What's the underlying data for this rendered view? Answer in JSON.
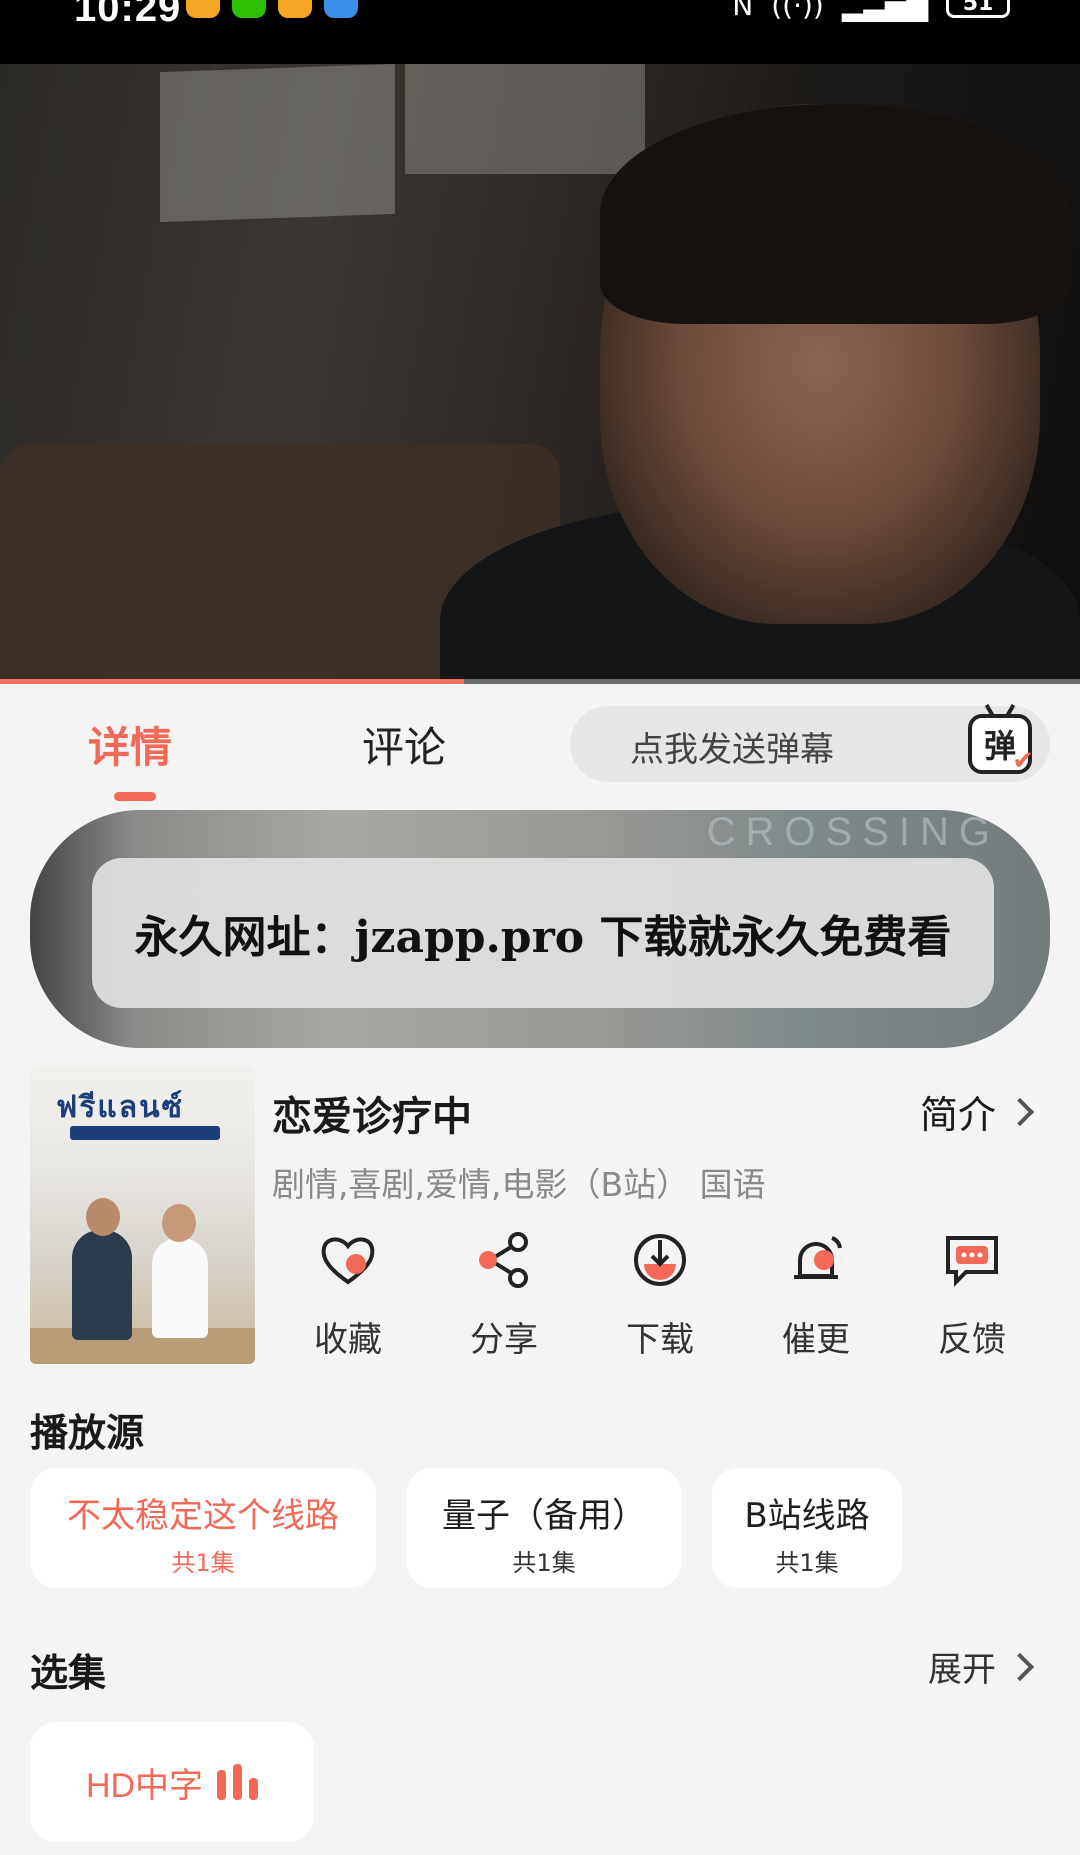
{
  "status_bar": {
    "time": "10:29",
    "battery": "51"
  },
  "video": {
    "progress_fraction": 0.43
  },
  "tabs": {
    "detail": "详情",
    "comment": "评论",
    "active": "detail"
  },
  "danmaku": {
    "placeholder": "点我发送弹幕",
    "icon_glyph": "弹"
  },
  "banner": {
    "text": "永久网址：jzapp.pro 下载就永久免费看",
    "bg_text": "CROSSING"
  },
  "poster": {
    "title": "ฟรีแลนซ์"
  },
  "show": {
    "title": "恋爱诊疗中",
    "intro_label": "简介",
    "meta": "剧情,喜剧,爱情,电影（B站） 国语"
  },
  "actions": [
    {
      "label": "收藏",
      "icon": "heart-icon"
    },
    {
      "label": "分享",
      "icon": "share-icon"
    },
    {
      "label": "下载",
      "icon": "download-icon"
    },
    {
      "label": "催更",
      "icon": "bell-icon"
    },
    {
      "label": "反馈",
      "icon": "feedback-icon"
    }
  ],
  "play_sources": {
    "title": "播放源",
    "items": [
      {
        "name": "不太稳定这个线路",
        "count": "共1集",
        "active": true
      },
      {
        "name": "量子（备用）",
        "count": "共1集",
        "active": false
      },
      {
        "name": "B站线路",
        "count": "共1集",
        "active": false
      }
    ]
  },
  "episodes": {
    "title": "选集",
    "expand_label": "展开",
    "items": [
      {
        "label": "HD中字",
        "playing": true
      }
    ]
  },
  "colors": {
    "accent": "#f26a57",
    "background": "#f4f4f4"
  }
}
